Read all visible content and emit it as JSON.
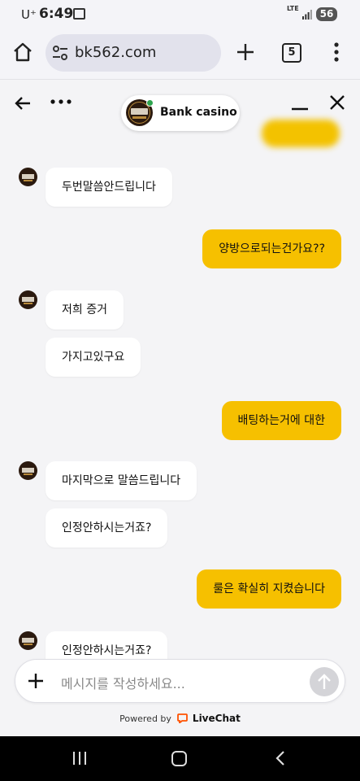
{
  "status_bar": {
    "carrier": "U⁺",
    "time": "6:49",
    "network": "LTE",
    "battery": "56"
  },
  "browser": {
    "url": "bk562.com",
    "tab_count": "5"
  },
  "chat": {
    "agent_name": "Bank casino",
    "avatar_text": "뱅카지",
    "messages": [
      {
        "direction": "in",
        "text": "두번말씀안드립니다"
      },
      {
        "direction": "out",
        "text": "양방으로되는건가요??"
      },
      {
        "direction": "in",
        "text": "저희 증거"
      },
      {
        "direction": "in",
        "text": "가지고있구요"
      },
      {
        "direction": "out",
        "text": "배팅하는거에 대한"
      },
      {
        "direction": "in",
        "text": "마지막으로 말씀드립니다"
      },
      {
        "direction": "in",
        "text": "인정안하시는거죠?"
      },
      {
        "direction": "out",
        "text": "룰은 확실히 지켰습니다"
      },
      {
        "direction": "in",
        "text": "인정안하시는거죠?"
      }
    ],
    "composer": {
      "placeholder": "메시지를 작성하세요..."
    },
    "powered_prefix": "Powered by",
    "powered_brand": "LiveChat"
  },
  "colors": {
    "accent": "#f6c000",
    "online": "#2ea44f",
    "livechat": "#ff5100"
  },
  "icons": [
    "home-icon",
    "tune-icon",
    "plus-icon",
    "tabs-icon",
    "more-vert-icon",
    "arrow-left-icon",
    "more-horiz-icon",
    "minimize-icon",
    "close-icon",
    "send-arrow-icon",
    "livechat-icon",
    "recents-icon",
    "android-home-icon",
    "android-back-icon"
  ]
}
